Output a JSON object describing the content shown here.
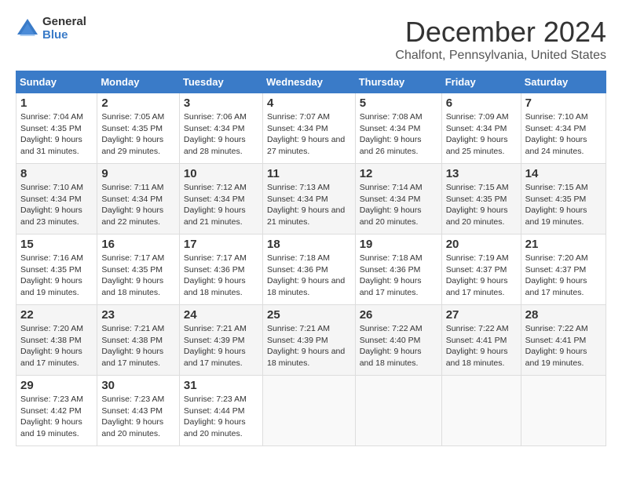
{
  "logo": {
    "line1": "General",
    "line2": "Blue"
  },
  "title": "December 2024",
  "subtitle": "Chalfont, Pennsylvania, United States",
  "days_header": [
    "Sunday",
    "Monday",
    "Tuesday",
    "Wednesday",
    "Thursday",
    "Friday",
    "Saturday"
  ],
  "weeks": [
    [
      {
        "day": 1,
        "sunrise": "7:04 AM",
        "sunset": "4:35 PM",
        "daylight": "9 hours and 31 minutes."
      },
      {
        "day": 2,
        "sunrise": "7:05 AM",
        "sunset": "4:35 PM",
        "daylight": "9 hours and 29 minutes."
      },
      {
        "day": 3,
        "sunrise": "7:06 AM",
        "sunset": "4:34 PM",
        "daylight": "9 hours and 28 minutes."
      },
      {
        "day": 4,
        "sunrise": "7:07 AM",
        "sunset": "4:34 PM",
        "daylight": "9 hours and 27 minutes."
      },
      {
        "day": 5,
        "sunrise": "7:08 AM",
        "sunset": "4:34 PM",
        "daylight": "9 hours and 26 minutes."
      },
      {
        "day": 6,
        "sunrise": "7:09 AM",
        "sunset": "4:34 PM",
        "daylight": "9 hours and 25 minutes."
      },
      {
        "day": 7,
        "sunrise": "7:10 AM",
        "sunset": "4:34 PM",
        "daylight": "9 hours and 24 minutes."
      }
    ],
    [
      {
        "day": 8,
        "sunrise": "7:10 AM",
        "sunset": "4:34 PM",
        "daylight": "9 hours and 23 minutes."
      },
      {
        "day": 9,
        "sunrise": "7:11 AM",
        "sunset": "4:34 PM",
        "daylight": "9 hours and 22 minutes."
      },
      {
        "day": 10,
        "sunrise": "7:12 AM",
        "sunset": "4:34 PM",
        "daylight": "9 hours and 21 minutes."
      },
      {
        "day": 11,
        "sunrise": "7:13 AM",
        "sunset": "4:34 PM",
        "daylight": "9 hours and 21 minutes."
      },
      {
        "day": 12,
        "sunrise": "7:14 AM",
        "sunset": "4:34 PM",
        "daylight": "9 hours and 20 minutes."
      },
      {
        "day": 13,
        "sunrise": "7:15 AM",
        "sunset": "4:35 PM",
        "daylight": "9 hours and 20 minutes."
      },
      {
        "day": 14,
        "sunrise": "7:15 AM",
        "sunset": "4:35 PM",
        "daylight": "9 hours and 19 minutes."
      }
    ],
    [
      {
        "day": 15,
        "sunrise": "7:16 AM",
        "sunset": "4:35 PM",
        "daylight": "9 hours and 19 minutes."
      },
      {
        "day": 16,
        "sunrise": "7:17 AM",
        "sunset": "4:35 PM",
        "daylight": "9 hours and 18 minutes."
      },
      {
        "day": 17,
        "sunrise": "7:17 AM",
        "sunset": "4:36 PM",
        "daylight": "9 hours and 18 minutes."
      },
      {
        "day": 18,
        "sunrise": "7:18 AM",
        "sunset": "4:36 PM",
        "daylight": "9 hours and 18 minutes."
      },
      {
        "day": 19,
        "sunrise": "7:18 AM",
        "sunset": "4:36 PM",
        "daylight": "9 hours and 17 minutes."
      },
      {
        "day": 20,
        "sunrise": "7:19 AM",
        "sunset": "4:37 PM",
        "daylight": "9 hours and 17 minutes."
      },
      {
        "day": 21,
        "sunrise": "7:20 AM",
        "sunset": "4:37 PM",
        "daylight": "9 hours and 17 minutes."
      }
    ],
    [
      {
        "day": 22,
        "sunrise": "7:20 AM",
        "sunset": "4:38 PM",
        "daylight": "9 hours and 17 minutes."
      },
      {
        "day": 23,
        "sunrise": "7:21 AM",
        "sunset": "4:38 PM",
        "daylight": "9 hours and 17 minutes."
      },
      {
        "day": 24,
        "sunrise": "7:21 AM",
        "sunset": "4:39 PM",
        "daylight": "9 hours and 17 minutes."
      },
      {
        "day": 25,
        "sunrise": "7:21 AM",
        "sunset": "4:39 PM",
        "daylight": "9 hours and 18 minutes."
      },
      {
        "day": 26,
        "sunrise": "7:22 AM",
        "sunset": "4:40 PM",
        "daylight": "9 hours and 18 minutes."
      },
      {
        "day": 27,
        "sunrise": "7:22 AM",
        "sunset": "4:41 PM",
        "daylight": "9 hours and 18 minutes."
      },
      {
        "day": 28,
        "sunrise": "7:22 AM",
        "sunset": "4:41 PM",
        "daylight": "9 hours and 19 minutes."
      }
    ],
    [
      {
        "day": 29,
        "sunrise": "7:23 AM",
        "sunset": "4:42 PM",
        "daylight": "9 hours and 19 minutes."
      },
      {
        "day": 30,
        "sunrise": "7:23 AM",
        "sunset": "4:43 PM",
        "daylight": "9 hours and 20 minutes."
      },
      {
        "day": 31,
        "sunrise": "7:23 AM",
        "sunset": "4:44 PM",
        "daylight": "9 hours and 20 minutes."
      },
      null,
      null,
      null,
      null
    ]
  ]
}
